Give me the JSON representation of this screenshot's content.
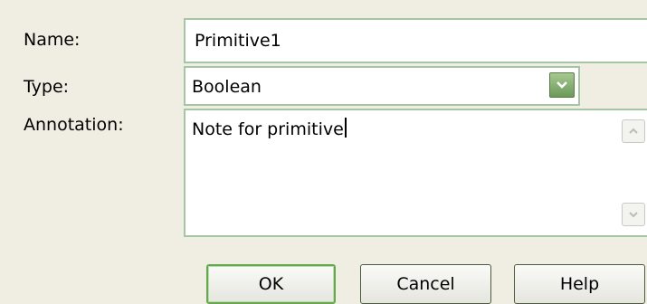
{
  "form": {
    "name_label": "Name:",
    "name_value": "Primitive1",
    "type_label": "Type:",
    "type_value": "Boolean",
    "annotation_label": "Annotation:",
    "annotation_value": "Note for primitive"
  },
  "buttons": {
    "ok": "OK",
    "cancel": "Cancel",
    "help": "Help"
  },
  "icons": {
    "type_dropdown": "chevron-down-icon",
    "scroll_up": "scroll-up-arrow-icon",
    "scroll_down": "scroll-down-arrow-icon"
  },
  "colors": {
    "background": "#f0eee3",
    "field_border": "#a6c5a4",
    "accent_green": "#6c9a5a"
  }
}
